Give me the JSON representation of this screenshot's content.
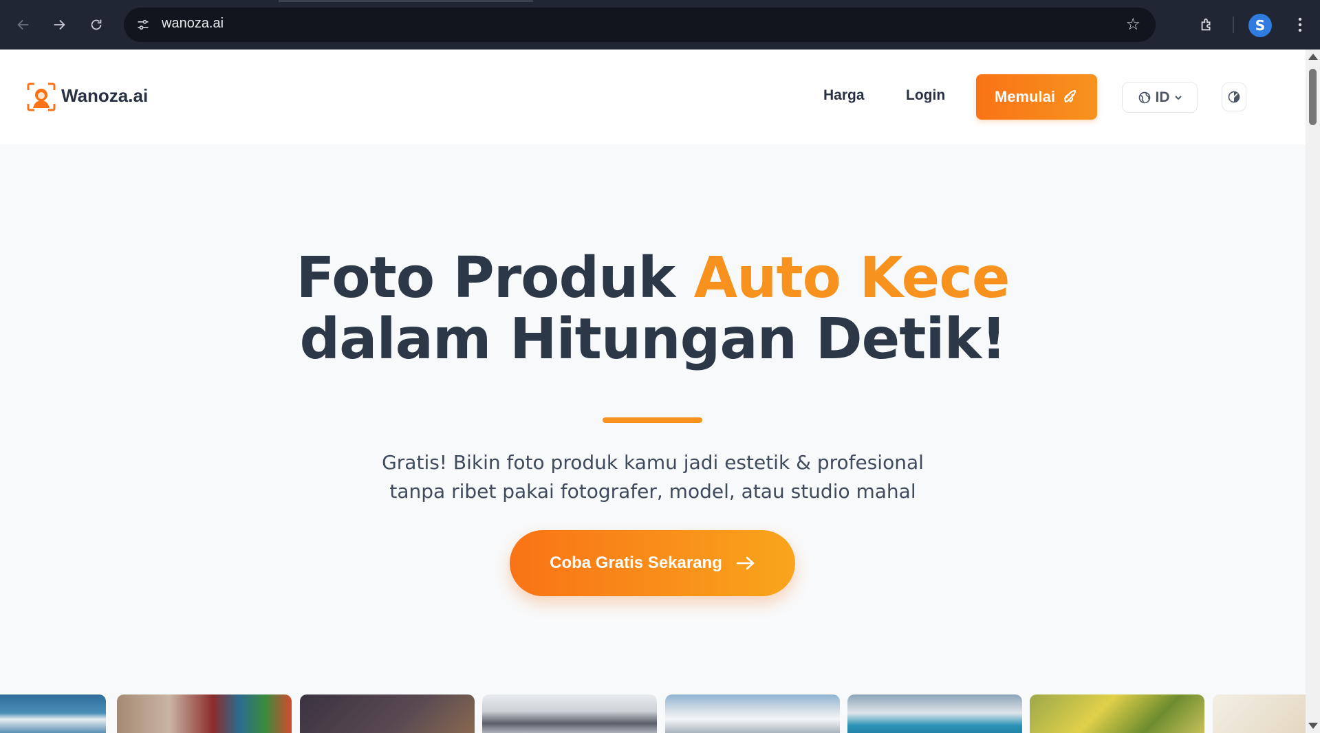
{
  "browser": {
    "url": "wanoza.ai",
    "icons": [
      "back-icon",
      "forward-icon",
      "reload-icon",
      "site-settings-icon",
      "bookmark-star-icon",
      "extensions-icon",
      "profile-icon",
      "menu-icon"
    ]
  },
  "header": {
    "brand": "Wanoza.ai",
    "nav": {
      "pricing": "Harga",
      "login": "Login"
    },
    "cta_label": "Memulai",
    "language": "ID"
  },
  "hero": {
    "title_part1": "Foto Produk ",
    "title_accent": "Auto Kece",
    "title_part2": "dalam Hitungan Detik!",
    "subtitle_line1": "Gratis! Bikin foto produk kamu jadi estetik & profesional",
    "subtitle_line2": "tanpa ribet pakai fotografer, model, atau studio mahal",
    "cta_label": "Coba Gratis Sekarang"
  },
  "colors": {
    "accent": "#f7921e",
    "heading": "#2c3748",
    "chrome_bg": "#202633"
  }
}
